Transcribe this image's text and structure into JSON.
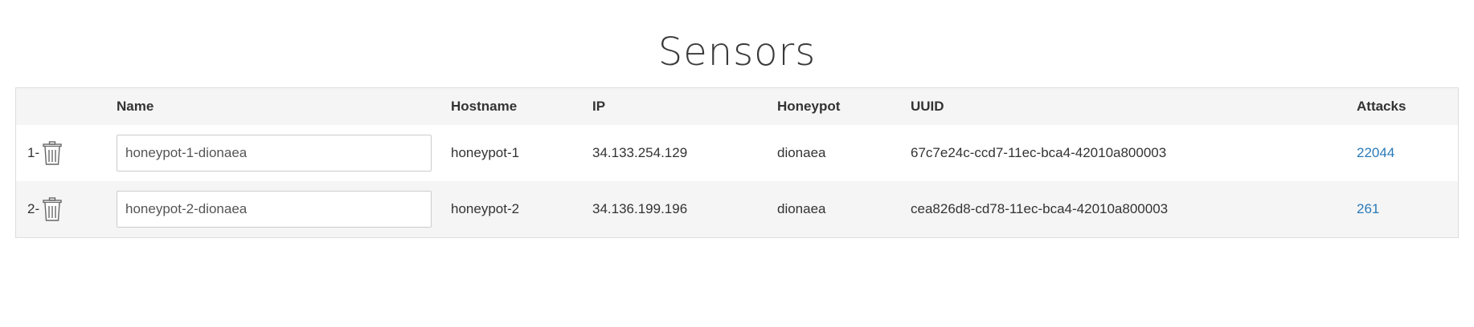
{
  "page": {
    "title": "Sensors"
  },
  "table": {
    "headers": {
      "index": "",
      "name": "Name",
      "hostname": "Hostname",
      "ip": "IP",
      "honeypot": "Honeypot",
      "uuid": "UUID",
      "attacks": "Attacks"
    },
    "rows": [
      {
        "index": "1-",
        "delete_icon": "trash-icon",
        "name": "honeypot-1-dionaea",
        "hostname": "honeypot-1",
        "ip": "34.133.254.129",
        "honeypot": "dionaea",
        "uuid": "67c7e24c-ccd7-11ec-bca4-42010a800003",
        "attacks": "22044"
      },
      {
        "index": "2-",
        "delete_icon": "trash-icon",
        "name": "honeypot-2-dionaea",
        "hostname": "honeypot-2",
        "ip": "34.136.199.196",
        "honeypot": "dionaea",
        "uuid": "cea826d8-cd78-11ec-bca4-42010a800003",
        "attacks": "261"
      }
    ]
  },
  "colors": {
    "header_bg": "#f5f5f5",
    "stripe_bg": "#f5f5f5",
    "link": "#2a7ab8",
    "border": "#dddddd"
  }
}
